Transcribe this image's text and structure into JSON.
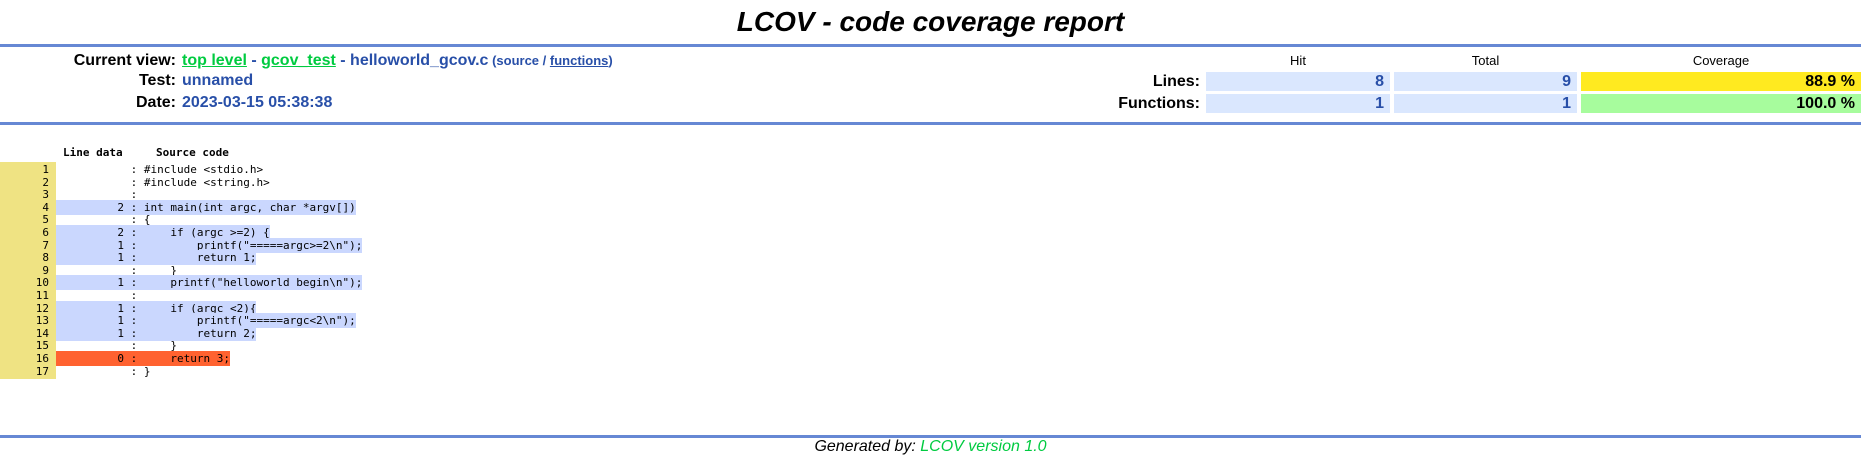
{
  "page_title": "LCOV - code coverage report",
  "header": {
    "current_view_label": "Current view:",
    "breadcrumb": {
      "top_level": "top level",
      "sep1": " - ",
      "dir": "gcov_test",
      "sep2": " - ",
      "file": "helloworld_gcov.c",
      "paren_open": " (",
      "source": "source",
      "slash": " / ",
      "functions": "functions",
      "paren_close": ")"
    },
    "test_label": "Test:",
    "test_value": "unnamed",
    "date_label": "Date:",
    "date_value": "2023-03-15 05:38:38"
  },
  "stats": {
    "col_hit": "Hit",
    "col_total": "Total",
    "col_coverage": "Coverage",
    "lines": {
      "label": "Lines:",
      "hit": "8",
      "total": "9",
      "coverage": "88.9 %"
    },
    "functions": {
      "label": "Functions:",
      "hit": "1",
      "total": "1",
      "coverage": "100.0 %"
    }
  },
  "source": {
    "header_line_data": "Line data",
    "header_source_code": "Source code",
    "lines": [
      {
        "num": "1",
        "count": "",
        "code": "#include <stdio.h>",
        "status": "none"
      },
      {
        "num": "2",
        "count": "",
        "code": "#include <string.h>",
        "status": "none"
      },
      {
        "num": "3",
        "count": "",
        "code": "",
        "status": "none"
      },
      {
        "num": "4",
        "count": "2",
        "code": "int main(int argc, char *argv[])",
        "status": "covered"
      },
      {
        "num": "5",
        "count": "",
        "code": "{",
        "status": "none"
      },
      {
        "num": "6",
        "count": "2",
        "code": "    if (argc >=2) {",
        "status": "covered"
      },
      {
        "num": "7",
        "count": "1",
        "code": "        printf(\"=====argc>=2\\n\");",
        "status": "covered"
      },
      {
        "num": "8",
        "count": "1",
        "code": "        return 1;",
        "status": "covered"
      },
      {
        "num": "9",
        "count": "",
        "code": "    }",
        "status": "none"
      },
      {
        "num": "10",
        "count": "1",
        "code": "    printf(\"helloworld begin\\n\");",
        "status": "covered"
      },
      {
        "num": "11",
        "count": "",
        "code": "",
        "status": "none"
      },
      {
        "num": "12",
        "count": "1",
        "code": "    if (argc <2){",
        "status": "covered"
      },
      {
        "num": "13",
        "count": "1",
        "code": "        printf(\"=====argc<2\\n\");",
        "status": "covered"
      },
      {
        "num": "14",
        "count": "1",
        "code": "        return 2;",
        "status": "covered"
      },
      {
        "num": "15",
        "count": "",
        "code": "    }",
        "status": "none"
      },
      {
        "num": "16",
        "count": "0",
        "code": "    return 3;",
        "status": "uncovered"
      },
      {
        "num": "17",
        "count": "",
        "code": "}",
        "status": "none"
      }
    ]
  },
  "footer": {
    "generated_by": "Generated by: ",
    "lcov_version": "LCOV version 1.0"
  },
  "colors": {
    "ruler": "#6688d4",
    "link_green": "#00cb40",
    "value_blue": "#284fa8",
    "line_num_bg": "#efe383",
    "covered_bg": "#cad7fe",
    "uncovered_bg": "#ff6230",
    "coverage_med_bg": "#ffea20",
    "coverage_hi_bg": "#a7fc9d"
  }
}
